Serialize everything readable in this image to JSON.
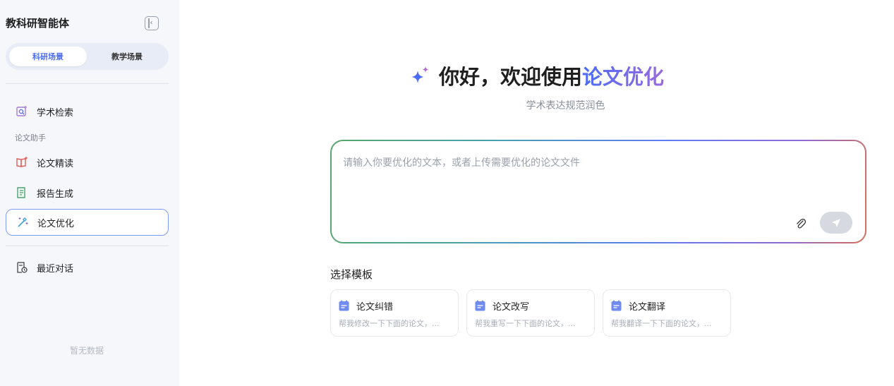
{
  "sidebar": {
    "app_title": "教科研智能体",
    "scene_tabs": [
      {
        "label": "科研场景",
        "active": true
      },
      {
        "label": "教学场景",
        "active": false
      }
    ],
    "nav": {
      "search": {
        "label": "学术检索",
        "icon": "search-image-icon"
      },
      "section_label": "论文助手",
      "reading": {
        "label": "论文精读",
        "icon": "open-book-icon"
      },
      "report": {
        "label": "报告生成",
        "icon": "report-list-icon"
      },
      "optimize": {
        "label": "论文优化",
        "icon": "magic-wand-icon",
        "active": true
      },
      "recent": {
        "label": "最近对话",
        "icon": "history-doc-icon"
      }
    },
    "empty_hint": "暂无数据"
  },
  "main": {
    "greeting": "你好，欢迎使用",
    "highlight": "论文优化",
    "subtitle": "学术表达规范润色",
    "input": {
      "placeholder": "请输入你要优化的文本，或者上传需要优化的论文文件",
      "value": ""
    },
    "template_heading": "选择模板",
    "templates": [
      {
        "title": "论文纠错",
        "desc": "帮我修改一下下面的论文，..."
      },
      {
        "title": "论文改写",
        "desc": "帮我重写一下下面的论文，..."
      },
      {
        "title": "论文翻译",
        "desc": "帮我翻译一下下面的论文，..."
      }
    ]
  },
  "colors": {
    "accent": "#4b6cf7",
    "accent_purple": "#9a6ae0",
    "sidebar_bg": "#f5f7fb",
    "send_disabled": "#d6d9e0"
  }
}
